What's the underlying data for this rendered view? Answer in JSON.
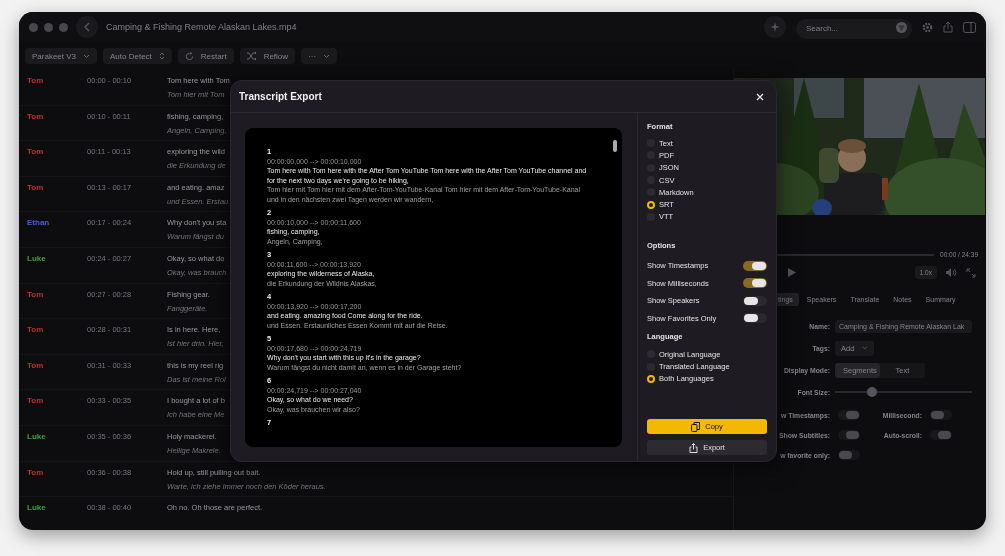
{
  "window": {
    "title": "Camping & Fishing Remote Alaskan Lakes.mp4"
  },
  "search": {
    "placeholder": "Search..."
  },
  "toolbar": {
    "model": "Parakeet V3",
    "language": "Auto Detect",
    "more": "···",
    "buttons": [
      {
        "label": "Restart",
        "kind": "restart"
      },
      {
        "label": "Reflow",
        "kind": "reflow"
      }
    ]
  },
  "segments": [
    {
      "speaker": "Tom",
      "color": "#b83030",
      "time": "00:00 - 00:10",
      "text": "Tom here with Tom",
      "translation": "Tom hier mit Tom"
    },
    {
      "speaker": "Tom",
      "color": "#b83030",
      "time": "00:10 - 00:11",
      "text": "fishing, camping,",
      "translation": "Angeln, Camping,"
    },
    {
      "speaker": "Tom",
      "color": "#b83030",
      "time": "00:11 - 00:13",
      "text": "exploring the wild",
      "translation": "die Erkundung de"
    },
    {
      "speaker": "Tom",
      "color": "#b83030",
      "time": "00:13 - 00:17",
      "text": "and eating. amaz",
      "translation": "und Essen. Erstau"
    },
    {
      "speaker": "Ethan",
      "color": "#4a62c8",
      "time": "00:17 - 00:24",
      "text": "Why don't you sta",
      "translation": "Warum fängst du"
    },
    {
      "speaker": "Luke",
      "color": "#3aa03a",
      "time": "00:24 - 00:27",
      "text": "Okay, so what do",
      "translation": "Okay, was brauch"
    },
    {
      "speaker": "Tom",
      "color": "#b83030",
      "time": "00:27 - 00:28",
      "text": "Fishing gear.",
      "translation": "Fanggeräte."
    },
    {
      "speaker": "Tom",
      "color": "#b83030",
      "time": "00:28 - 00:31",
      "text": "Is in here. Here,",
      "translation": "Ist hier drin. Hier,"
    },
    {
      "speaker": "Tom",
      "color": "#b83030",
      "time": "00:31 - 00:33",
      "text": "this is my reel rig",
      "translation": "Das ist meine Rol"
    },
    {
      "speaker": "Tom",
      "color": "#b83030",
      "time": "00:33 - 00:35",
      "text": "I bought a lot of b",
      "translation": "Ich habe eine Me"
    },
    {
      "speaker": "Luke",
      "color": "#3aa03a",
      "time": "00:35 - 00:36",
      "text": "Holy mackerel.",
      "translation": "Heilige Makrele."
    },
    {
      "speaker": "Tom",
      "color": "#b83030",
      "time": "00:36 - 00:38",
      "text": "Hold up, still pulling out bait.",
      "translation": "Warte, ich ziehe immer noch den Köder heraus."
    },
    {
      "speaker": "Luke",
      "color": "#3aa03a",
      "time": "00:38 - 00:40",
      "text": "Oh no. Oh those are perfect."
    }
  ],
  "player": {
    "time": "00:00 / 24:39",
    "speed": "1.0x"
  },
  "panel_tabs": [
    {
      "label": "tings",
      "selected": true
    },
    {
      "label": "Speakers",
      "selected": false
    },
    {
      "label": "Translate",
      "selected": false
    },
    {
      "label": "Notes",
      "selected": false
    },
    {
      "label": "Summary",
      "selected": false
    }
  ],
  "details": {
    "name_label": "Name:",
    "name_value": "Camping & Fishing Remote Alaskan Lak",
    "tags_label": "Tags:",
    "tags_value": "Add",
    "display_mode_label": "Display Mode:",
    "display_modes": [
      {
        "label": "Segments",
        "selected": true
      },
      {
        "label": "Text",
        "selected": false
      }
    ],
    "font_size_label": "Font Size:",
    "font_size": {
      "level": 0.27
    },
    "toggles": [
      {
        "label": "w Timestamps:",
        "on": true
      },
      {
        "label": "Millisecond:",
        "on": false
      },
      {
        "label": "Show Subtitles:",
        "on": true
      },
      {
        "label": "Auto-scroll:",
        "on": true
      },
      {
        "label": "w favorite only:",
        "on": false
      }
    ]
  },
  "dialog": {
    "title": "Transcript Export",
    "preview": [
      {
        "index": "1",
        "time": "00:00:00,000 --> 00:00:10,000",
        "text": "Tom here with Tom here with the After Tom YouTube Tom here with the After Tom YouTube channel and for the next two days we're going to be hiking,",
        "translation": "Tom hier mit Tom hier mit dem After-Tom-YouTube-Kanal Tom hier mit dem After-Tom-YouTube-Kanal und in den nächsten zwei Tagen werden wir wandern,"
      },
      {
        "index": "2",
        "time": "00:00:10,000 --> 00:00:11,600",
        "text": "fishing, camping,",
        "translation": "Angeln, Camping,"
      },
      {
        "index": "3",
        "time": "00:00:11,600 --> 00:00:13,920",
        "text": "exploring the wilderness of Alaska,",
        "translation": "die Erkundung der Wildnis Alaskas,"
      },
      {
        "index": "4",
        "time": "00:00:13,920 --> 00:00:17,200",
        "text": "and eating. amazing food Come along for the ride.",
        "translation": "und Essen. Erstaunliches Essen Kommt mit auf die Reise."
      },
      {
        "index": "5",
        "time": "00:00:17,680 --> 00:00:24,719",
        "text": "Why don't you start with this up it's in the garage?",
        "translation": "Warum fängst du nicht damit an, wenn es in der Garage steht?"
      },
      {
        "index": "6",
        "time": "00:00:24,719 --> 00:00:27,040",
        "text": "Okay, so what do we need?",
        "translation": "Okay, was brauchen wir also?"
      },
      {
        "index": "7"
      }
    ],
    "format": {
      "heading": "Format",
      "options": [
        {
          "label": "Text",
          "selected": false
        },
        {
          "label": "PDF",
          "selected": false
        },
        {
          "label": "JSON",
          "selected": false
        },
        {
          "label": "CSV",
          "selected": false
        },
        {
          "label": "Markdown",
          "selected": false
        },
        {
          "label": "SRT",
          "selected": true
        },
        {
          "label": "VTT",
          "selected": false
        }
      ]
    },
    "options": {
      "heading": "Options",
      "toggles": [
        {
          "label": "Show Timestamps",
          "on": true
        },
        {
          "label": "Show Milliseconds",
          "on": true
        },
        {
          "label": "Show Speakers",
          "on": false
        },
        {
          "label": "Show Favorites Only",
          "on": false
        }
      ]
    },
    "language": {
      "heading": "Language",
      "options": [
        {
          "label": "Original Language",
          "selected": false
        },
        {
          "label": "Translated Language",
          "selected": false
        },
        {
          "label": "Both Languages",
          "selected": true
        }
      ]
    },
    "buttons": [
      {
        "label": "Copy",
        "kind": "primary"
      },
      {
        "label": "Export",
        "kind": "secondary"
      }
    ]
  }
}
